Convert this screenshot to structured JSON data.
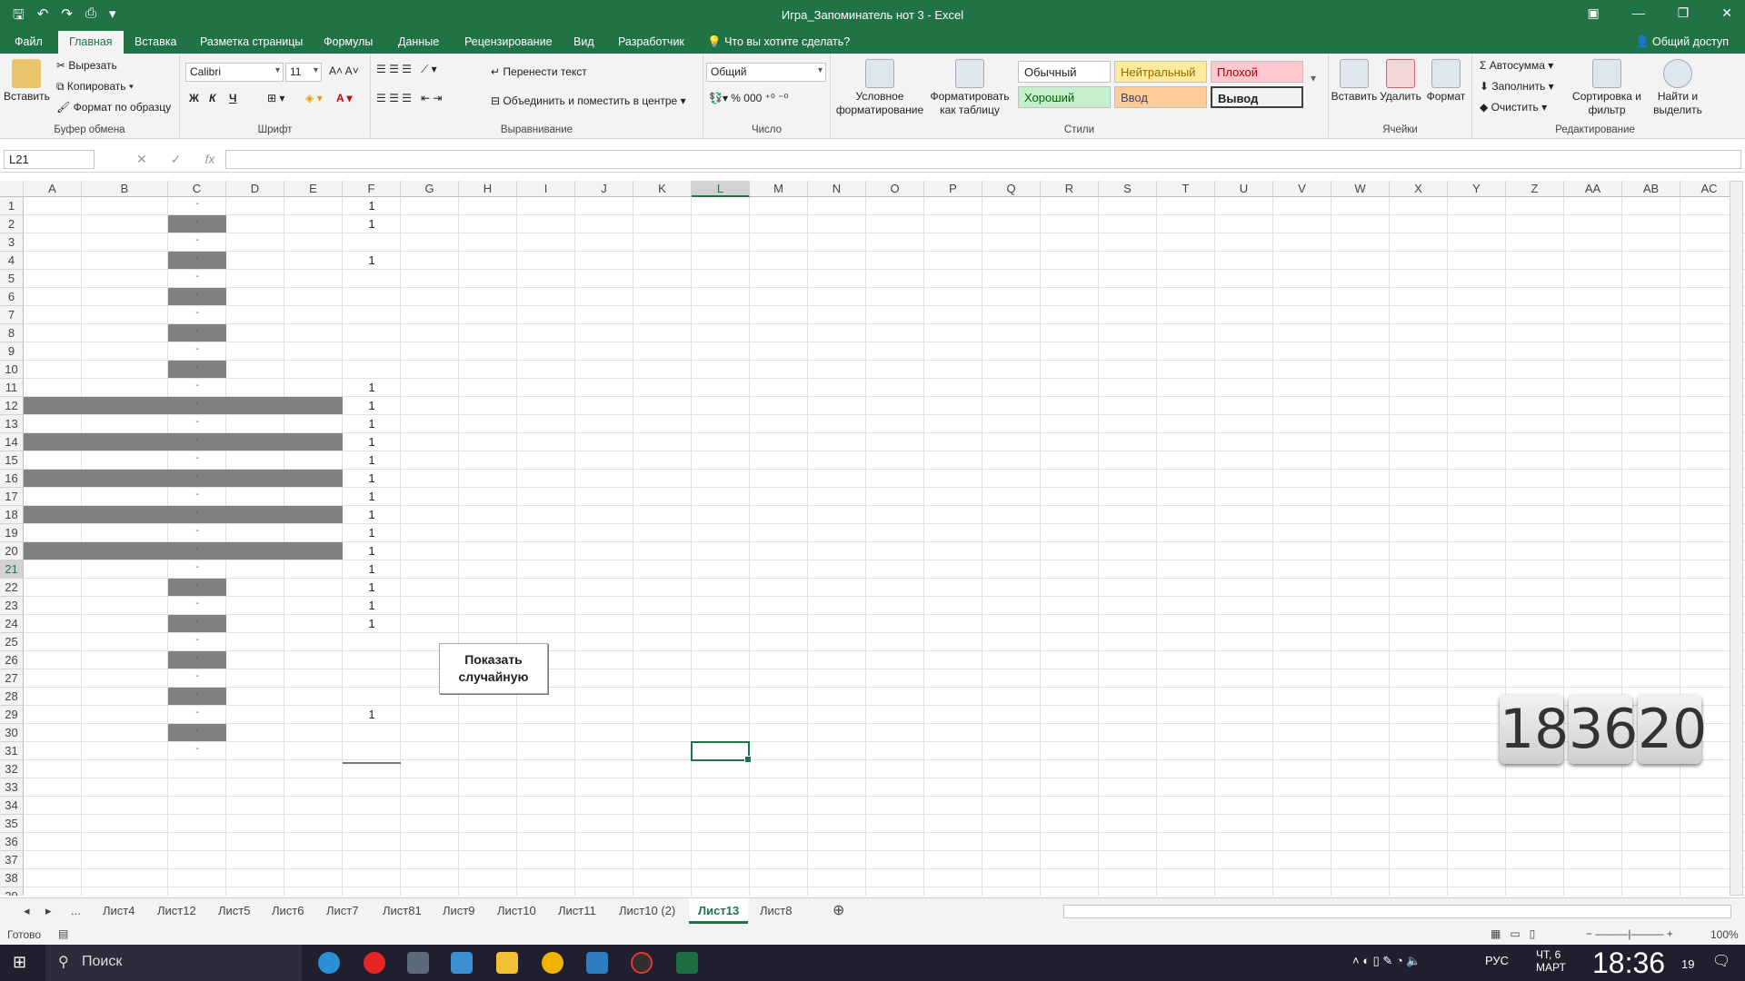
{
  "window": {
    "title": "Игра_Запоминатель нот 3 - Excel"
  },
  "menu": {
    "tabs": [
      "Файл",
      "Главная",
      "Вставка",
      "Разметка страницы",
      "Формулы",
      "Данные",
      "Рецензирование",
      "Вид",
      "Разработчик"
    ],
    "active": "Главная",
    "tell_me": "Что вы хотите сделать?",
    "share": "Общий доступ"
  },
  "ribbon": {
    "clipboard": {
      "paste": "Вставить",
      "cut": "Вырезать",
      "copy": "Копировать",
      "format_painter": "Формат по образцу",
      "label": "Буфер обмена"
    },
    "font": {
      "name": "Calibri",
      "size": "11",
      "label": "Шрифт",
      "bold": "Ж",
      "italic": "К",
      "underline": "Ч"
    },
    "alignment": {
      "wrap": "Перенести текст",
      "merge": "Объединить и поместить в центре",
      "label": "Выравнивание"
    },
    "number": {
      "format": "Общий",
      "label": "Число"
    },
    "styles": {
      "conditional": "Условное форматирование",
      "as_table": "Форматировать как таблицу",
      "normal": "Обычный",
      "neutral": "Нейтральный",
      "bad": "Плохой",
      "good": "Хороший",
      "input": "Ввод",
      "output": "Вывод",
      "label": "Стили"
    },
    "cells": {
      "insert": "Вставить",
      "delete": "Удалить",
      "format": "Формат",
      "label": "Ячейки"
    },
    "editing": {
      "autosum": "Автосумма",
      "fill": "Заполнить",
      "clear": "Очистить",
      "sort": "Сортировка и фильтр",
      "find": "Найти и выделить",
      "label": "Редактирование"
    }
  },
  "formula_bar": {
    "name_box": "L21",
    "fx": "fx",
    "formula": ""
  },
  "columns": [
    "A",
    "B",
    "C",
    "D",
    "E",
    "F",
    "G",
    "H",
    "I",
    "J",
    "K",
    "L",
    "M",
    "N",
    "O",
    "P",
    "Q",
    "R",
    "S",
    "T",
    "U",
    "V",
    "W",
    "X",
    "Y",
    "Z",
    "AA",
    "AB",
    "AC"
  ],
  "rows": [
    "1",
    "2",
    "3",
    "4",
    "5",
    "6",
    "7",
    "8",
    "9",
    "10",
    "11",
    "12",
    "13",
    "14",
    "15",
    "16",
    "17",
    "18",
    "19",
    "20",
    "21",
    "22",
    "23",
    "24",
    "25",
    "26",
    "27",
    "28",
    "29",
    "30",
    "31",
    "32",
    "33",
    "34",
    "35",
    "36",
    "37",
    "38",
    "39"
  ],
  "cells": {
    "f_values": {
      "1": "1",
      "2": "1",
      "4": "1",
      "11": "1",
      "12": "1",
      "13": "1",
      "14": "1",
      "15": "1",
      "16": "1",
      "17": "1",
      "18": "1",
      "19": "1",
      "20": "1",
      "21": "1",
      "22": "1",
      "23": "1",
      "24": "1",
      "29": "1"
    },
    "c_marker": "-",
    "shaded_c_rows": [
      2,
      4,
      6,
      8,
      10,
      22,
      24,
      26,
      28,
      30
    ],
    "shaded_full_rows": [
      12,
      14,
      16,
      18,
      20
    ]
  },
  "control_button": {
    "label": "Показать случайную"
  },
  "clock": {
    "hours": "18",
    "minutes": "36",
    "seconds": "20"
  },
  "sheet_tabs": {
    "items": [
      "...",
      "Лист4",
      "Лист12",
      "Лист5",
      "Лист6",
      "Лист7",
      "Лист81",
      "Лист9",
      "Лист10",
      "Лист11",
      "Лист10 (2)",
      "Лист13",
      "Лист8"
    ],
    "active": "Лист13"
  },
  "status": {
    "ready": "Готово",
    "zoom": "100%"
  },
  "taskbar": {
    "search": "Поиск",
    "lang": "РУС",
    "date": "ЧТ, 6 МАРТ",
    "time": "18:36",
    "seconds": "19"
  }
}
